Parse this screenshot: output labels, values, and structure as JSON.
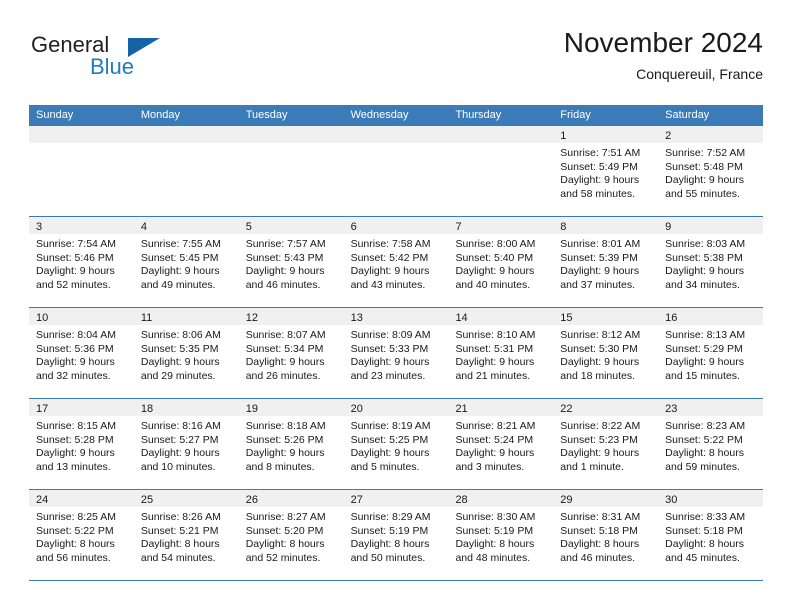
{
  "brand": {
    "word_one": "General",
    "word_two": "Blue",
    "logo_icon": "triangle-logo-icon"
  },
  "header": {
    "title": "November 2024",
    "location": "Conquereuil, France"
  },
  "calendar": {
    "weekday_headers": [
      "Sunday",
      "Monday",
      "Tuesday",
      "Wednesday",
      "Thursday",
      "Friday",
      "Saturday"
    ],
    "accent_color": "#3b7cb8",
    "daynum_band_color": "#f0f0f0",
    "weeks": [
      [
        {
          "day": "",
          "lines": []
        },
        {
          "day": "",
          "lines": []
        },
        {
          "day": "",
          "lines": []
        },
        {
          "day": "",
          "lines": []
        },
        {
          "day": "",
          "lines": []
        },
        {
          "day": "1",
          "lines": [
            "Sunrise: 7:51 AM",
            "Sunset: 5:49 PM",
            "Daylight: 9 hours",
            "and 58 minutes."
          ]
        },
        {
          "day": "2",
          "lines": [
            "Sunrise: 7:52 AM",
            "Sunset: 5:48 PM",
            "Daylight: 9 hours",
            "and 55 minutes."
          ]
        }
      ],
      [
        {
          "day": "3",
          "lines": [
            "Sunrise: 7:54 AM",
            "Sunset: 5:46 PM",
            "Daylight: 9 hours",
            "and 52 minutes."
          ]
        },
        {
          "day": "4",
          "lines": [
            "Sunrise: 7:55 AM",
            "Sunset: 5:45 PM",
            "Daylight: 9 hours",
            "and 49 minutes."
          ]
        },
        {
          "day": "5",
          "lines": [
            "Sunrise: 7:57 AM",
            "Sunset: 5:43 PM",
            "Daylight: 9 hours",
            "and 46 minutes."
          ]
        },
        {
          "day": "6",
          "lines": [
            "Sunrise: 7:58 AM",
            "Sunset: 5:42 PM",
            "Daylight: 9 hours",
            "and 43 minutes."
          ]
        },
        {
          "day": "7",
          "lines": [
            "Sunrise: 8:00 AM",
            "Sunset: 5:40 PM",
            "Daylight: 9 hours",
            "and 40 minutes."
          ]
        },
        {
          "day": "8",
          "lines": [
            "Sunrise: 8:01 AM",
            "Sunset: 5:39 PM",
            "Daylight: 9 hours",
            "and 37 minutes."
          ]
        },
        {
          "day": "9",
          "lines": [
            "Sunrise: 8:03 AM",
            "Sunset: 5:38 PM",
            "Daylight: 9 hours",
            "and 34 minutes."
          ]
        }
      ],
      [
        {
          "day": "10",
          "lines": [
            "Sunrise: 8:04 AM",
            "Sunset: 5:36 PM",
            "Daylight: 9 hours",
            "and 32 minutes."
          ]
        },
        {
          "day": "11",
          "lines": [
            "Sunrise: 8:06 AM",
            "Sunset: 5:35 PM",
            "Daylight: 9 hours",
            "and 29 minutes."
          ]
        },
        {
          "day": "12",
          "lines": [
            "Sunrise: 8:07 AM",
            "Sunset: 5:34 PM",
            "Daylight: 9 hours",
            "and 26 minutes."
          ]
        },
        {
          "day": "13",
          "lines": [
            "Sunrise: 8:09 AM",
            "Sunset: 5:33 PM",
            "Daylight: 9 hours",
            "and 23 minutes."
          ]
        },
        {
          "day": "14",
          "lines": [
            "Sunrise: 8:10 AM",
            "Sunset: 5:31 PM",
            "Daylight: 9 hours",
            "and 21 minutes."
          ]
        },
        {
          "day": "15",
          "lines": [
            "Sunrise: 8:12 AM",
            "Sunset: 5:30 PM",
            "Daylight: 9 hours",
            "and 18 minutes."
          ]
        },
        {
          "day": "16",
          "lines": [
            "Sunrise: 8:13 AM",
            "Sunset: 5:29 PM",
            "Daylight: 9 hours",
            "and 15 minutes."
          ]
        }
      ],
      [
        {
          "day": "17",
          "lines": [
            "Sunrise: 8:15 AM",
            "Sunset: 5:28 PM",
            "Daylight: 9 hours",
            "and 13 minutes."
          ]
        },
        {
          "day": "18",
          "lines": [
            "Sunrise: 8:16 AM",
            "Sunset: 5:27 PM",
            "Daylight: 9 hours",
            "and 10 minutes."
          ]
        },
        {
          "day": "19",
          "lines": [
            "Sunrise: 8:18 AM",
            "Sunset: 5:26 PM",
            "Daylight: 9 hours",
            "and 8 minutes."
          ]
        },
        {
          "day": "20",
          "lines": [
            "Sunrise: 8:19 AM",
            "Sunset: 5:25 PM",
            "Daylight: 9 hours",
            "and 5 minutes."
          ]
        },
        {
          "day": "21",
          "lines": [
            "Sunrise: 8:21 AM",
            "Sunset: 5:24 PM",
            "Daylight: 9 hours",
            "and 3 minutes."
          ]
        },
        {
          "day": "22",
          "lines": [
            "Sunrise: 8:22 AM",
            "Sunset: 5:23 PM",
            "Daylight: 9 hours",
            "and 1 minute."
          ]
        },
        {
          "day": "23",
          "lines": [
            "Sunrise: 8:23 AM",
            "Sunset: 5:22 PM",
            "Daylight: 8 hours",
            "and 59 minutes."
          ]
        }
      ],
      [
        {
          "day": "24",
          "lines": [
            "Sunrise: 8:25 AM",
            "Sunset: 5:22 PM",
            "Daylight: 8 hours",
            "and 56 minutes."
          ]
        },
        {
          "day": "25",
          "lines": [
            "Sunrise: 8:26 AM",
            "Sunset: 5:21 PM",
            "Daylight: 8 hours",
            "and 54 minutes."
          ]
        },
        {
          "day": "26",
          "lines": [
            "Sunrise: 8:27 AM",
            "Sunset: 5:20 PM",
            "Daylight: 8 hours",
            "and 52 minutes."
          ]
        },
        {
          "day": "27",
          "lines": [
            "Sunrise: 8:29 AM",
            "Sunset: 5:19 PM",
            "Daylight: 8 hours",
            "and 50 minutes."
          ]
        },
        {
          "day": "28",
          "lines": [
            "Sunrise: 8:30 AM",
            "Sunset: 5:19 PM",
            "Daylight: 8 hours",
            "and 48 minutes."
          ]
        },
        {
          "day": "29",
          "lines": [
            "Sunrise: 8:31 AM",
            "Sunset: 5:18 PM",
            "Daylight: 8 hours",
            "and 46 minutes."
          ]
        },
        {
          "day": "30",
          "lines": [
            "Sunrise: 8:33 AM",
            "Sunset: 5:18 PM",
            "Daylight: 8 hours",
            "and 45 minutes."
          ]
        }
      ]
    ]
  }
}
